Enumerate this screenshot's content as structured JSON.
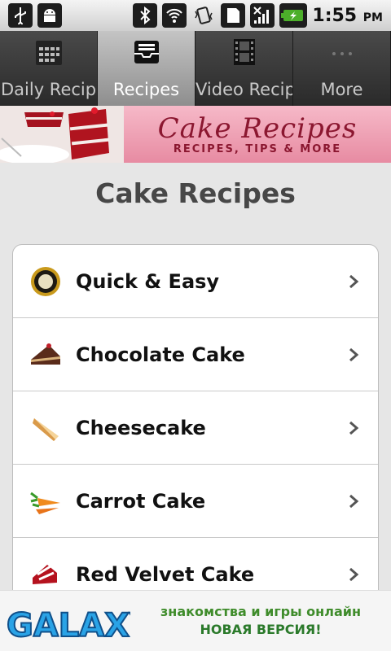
{
  "status_bar": {
    "time": "1:55",
    "ampm": "PM",
    "icons": [
      "usb-icon",
      "android-icon",
      "bluetooth-icon",
      "wifi-icon",
      "vibrate-icon",
      "sd-card-icon",
      "signal-icon",
      "battery-icon"
    ]
  },
  "tabs": [
    {
      "label": "Daily Recipes",
      "icon": "calendar-icon"
    },
    {
      "label": "Recipes",
      "icon": "inbox-icon"
    },
    {
      "label": "Video Recipe",
      "icon": "film-icon"
    },
    {
      "label": "More",
      "icon": "more-icon"
    }
  ],
  "banner": {
    "title": "Cake Recipes",
    "subtitle": "RECIPES, TIPS & MORE"
  },
  "page": {
    "title": "Cake Recipes"
  },
  "categories": [
    {
      "label": "Quick & Easy",
      "icon": "timer-icon"
    },
    {
      "label": "Chocolate Cake",
      "icon": "chocolate-cake-icon"
    },
    {
      "label": "Cheesecake",
      "icon": "cheesecake-icon"
    },
    {
      "label": "Carrot Cake",
      "icon": "carrot-icon"
    },
    {
      "label": "Red Velvet Cake",
      "icon": "red-velvet-icon"
    }
  ],
  "ad": {
    "brand": "GALAXY",
    "line1": "знакомства и игры онлайн",
    "line2": "НОВАЯ ВЕРСИЯ!"
  },
  "colors": {
    "tab_active": "#a8a8a8",
    "banner_pink": "#ef9fb3",
    "banner_text": "#8b1730",
    "ad_green": "#3f8c2b"
  }
}
